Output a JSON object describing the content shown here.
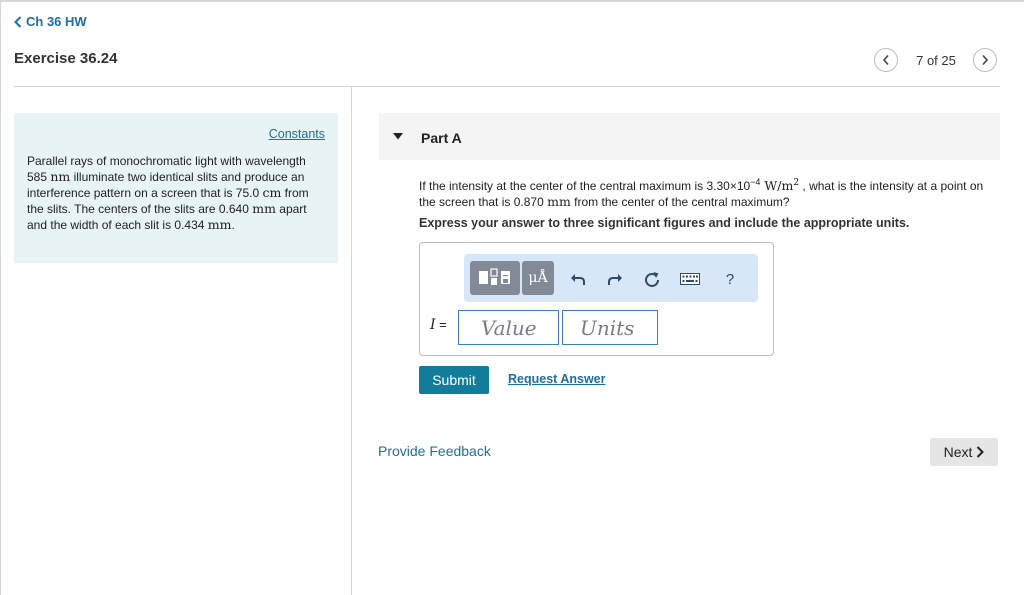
{
  "header": {
    "back_label": "Ch 36 HW",
    "exercise_title": "Exercise 36.24",
    "page_counter": "7 of 25"
  },
  "problem": {
    "constants_label": "Constants",
    "text_1": "Parallel rays of monochromatic light with wavelength 585 ",
    "unit_nm": "nm",
    "text_2": " illuminate two identical slits and produce an interference pattern on a screen that is 75.0 ",
    "unit_cm": "cm",
    "text_3": " from the slits. The centers of the slits are 0.640 ",
    "unit_mm_1": "mm",
    "text_4": " apart and the width of each slit is 0.434 ",
    "unit_mm_2": "mm",
    "text_5": "."
  },
  "part": {
    "label": "Part A",
    "q1": "If the intensity at the center of the central maximum is 3.30×10",
    "q_exp": "−4",
    "q_unit_w": " W/m",
    "q_unit_sq": "2",
    "q2": " , what is the intensity at a point on the screen that is 0.870 ",
    "q_unit_mm": "mm",
    "q3": " from the center of the central maximum?",
    "instruction": "Express your answer to three significant figures and include the appropriate units."
  },
  "answer": {
    "units_tool_label": "μÅ",
    "help_label": "?",
    "var_symbol": "I",
    "equals": " =",
    "value_placeholder": "Value",
    "units_placeholder": "Units"
  },
  "actions": {
    "submit_label": "Submit",
    "request_answer_label": "Request Answer"
  },
  "footer": {
    "feedback_label": "Provide Feedback",
    "next_label": "Next"
  },
  "icons": {
    "back": "chevron-left-icon",
    "prev": "chevron-left-icon",
    "next": "chevron-right-icon",
    "undo": "undo-icon",
    "redo": "redo-icon",
    "reset": "reset-icon",
    "keyboard": "keyboard-icon"
  },
  "colors": {
    "link": "#1b6fa5",
    "submit": "#127d9b",
    "problem_bg": "#e8f3f5",
    "toolbar_bg": "#d7e7f7",
    "tool_button": "#828a96"
  }
}
